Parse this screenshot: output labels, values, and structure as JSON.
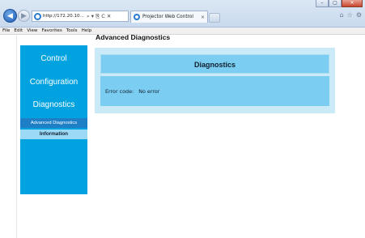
{
  "window": {
    "minimize_glyph": "–",
    "maximize_glyph": "▢",
    "close_glyph": "✕"
  },
  "browser": {
    "address": "http://172.20.10...",
    "address_controls": "⌕ ▾ ⎘ C ✕",
    "tab_title": "Projector Web Control",
    "tab_close": "×",
    "toolbar_icons": [
      "home-icon",
      "star-icon",
      "gear-icon"
    ],
    "toolbar_glyphs": [
      "⌂",
      "☆",
      "⚙"
    ]
  },
  "menu": {
    "items": [
      "File",
      "Edit",
      "View",
      "Favorites",
      "Tools",
      "Help"
    ]
  },
  "page": {
    "title": "Advanced Diagnostics"
  },
  "sidebar": {
    "items": [
      "Control",
      "Configuration",
      "Diagnostics"
    ],
    "subitems": [
      "Advanced Diagnostics",
      "Information"
    ]
  },
  "panel": {
    "heading": "Diagnostics",
    "error_label": "Error code:",
    "error_value": "No error"
  },
  "colors": {
    "sidebar_bg": "#00a3e0",
    "active_sub_bg": "#1f7fc6",
    "info_sub_bg": "#9bd9f6",
    "panel_bg": "#cbeaf8",
    "panel_box": "#7bcdf2"
  }
}
